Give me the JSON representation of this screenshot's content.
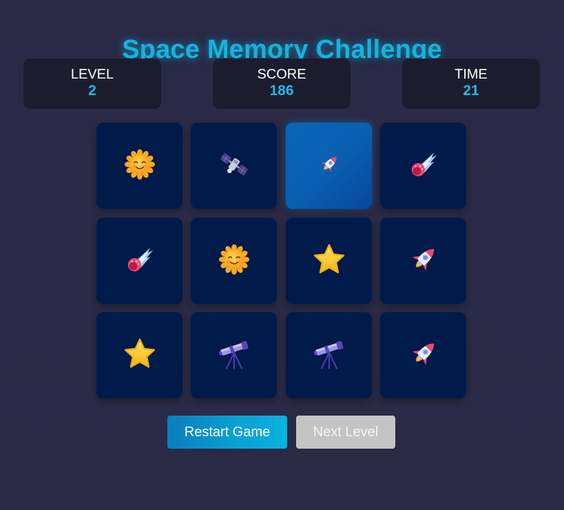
{
  "title": "Space Memory Challenge",
  "stats": {
    "level_label": "LEVEL",
    "level_value": "2",
    "score_label": "SCORE",
    "score_value": "186",
    "time_label": "TIME",
    "time_value": "21"
  },
  "cards": [
    {
      "icon": "sun-icon",
      "flipped": false
    },
    {
      "icon": "satellite-icon",
      "flipped": false
    },
    {
      "icon": "rocket-icon",
      "flipped": true
    },
    {
      "icon": "comet-icon",
      "flipped": false
    },
    {
      "icon": "comet-icon",
      "flipped": false
    },
    {
      "icon": "sun-icon",
      "flipped": false
    },
    {
      "icon": "star-icon",
      "flipped": false
    },
    {
      "icon": "rocket-icon",
      "flipped": false
    },
    {
      "icon": "star-icon",
      "flipped": false
    },
    {
      "icon": "telescope-icon",
      "flipped": false
    },
    {
      "icon": "telescope-icon",
      "flipped": false
    },
    {
      "icon": "rocket-icon",
      "flipped": false
    }
  ],
  "buttons": {
    "restart_label": "Restart Game",
    "next_label": "Next Level"
  },
  "colors": {
    "accent": "#13b4e0",
    "card_back": "#001a4a",
    "card_selected": "#0960b3",
    "panel": "#1c1c2e",
    "disabled_button": "#c4c4c4"
  }
}
